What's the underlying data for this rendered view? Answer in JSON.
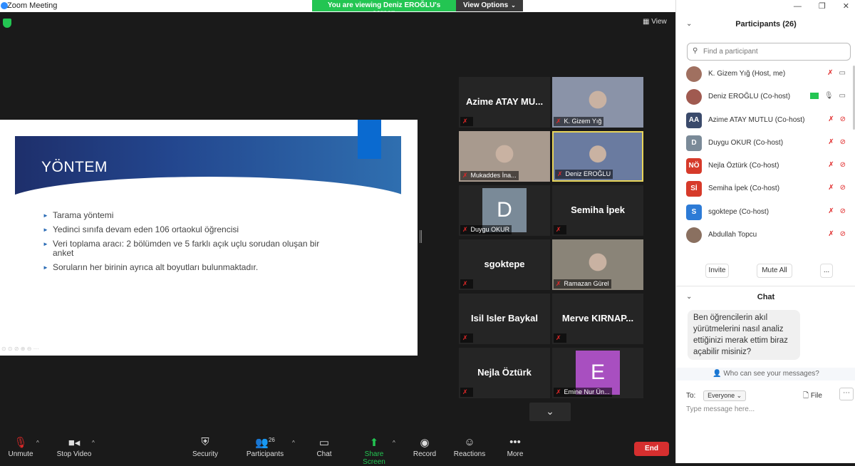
{
  "window": {
    "title": "Zoom Meeting"
  },
  "banner": {
    "viewing": "You are viewing Deniz EROĞLU's screen",
    "view_options": "View Options",
    "caret": "⌄"
  },
  "view_button": {
    "label": "View"
  },
  "slide": {
    "heading": "YÖNTEM",
    "bullets": [
      "Tarama yöntemi",
      "Yedinci sınıfa devam eden 106 ortaokul öğrencisi",
      "Veri toplama aracı: 2 bölümden ve 5 farklı açık uçlu sorudan oluşan bir anket",
      "Soruların her birinin ayrıca alt boyutları bulunmaktadır."
    ],
    "controls": "⊙ ⊙ ⊘ ⊕ ⊖ ⋯"
  },
  "tiles": [
    {
      "name": "Azime ATAY MU...",
      "label": "",
      "type": "name"
    },
    {
      "name": "",
      "label": "K. Gizem Yığ",
      "type": "video",
      "color": "#8a93a8"
    },
    {
      "name": "",
      "label": "Mukaddes İna...",
      "type": "video",
      "color": "#a89a8e"
    },
    {
      "name": "",
      "label": "Deniz EROĞLU",
      "type": "video",
      "color": "#6a7ba0",
      "active": true
    },
    {
      "name": "",
      "label": "Duygu OKUR",
      "type": "letter",
      "letter": "D",
      "color": "#7a8a98"
    },
    {
      "name": "Semiha İpek",
      "label": "",
      "type": "name"
    },
    {
      "name": "sgoktepe",
      "label": "",
      "type": "name"
    },
    {
      "name": "",
      "label": "Ramazan Gürel",
      "type": "video",
      "color": "#8a8478"
    },
    {
      "name": "Isil Isler Baykal",
      "label": "",
      "type": "name"
    },
    {
      "name": "Merve KIRNAP...",
      "label": "",
      "type": "name"
    },
    {
      "name": "Nejla Öztürk",
      "label": "",
      "type": "name"
    },
    {
      "name": "",
      "label": "Emine Nur Ün...",
      "type": "letter",
      "letter": "E",
      "color": "#a84fc0"
    }
  ],
  "toolbar": {
    "unmute": "Unmute",
    "stop_video": "Stop Video",
    "security": "Security",
    "participants": "Participants",
    "participants_count": "26",
    "chat": "Chat",
    "share_screen": "Share Screen",
    "record": "Record",
    "reactions": "Reactions",
    "more": "More",
    "end": "End"
  },
  "panel": {
    "participants_header": "Participants (26)",
    "search_placeholder": "Find a participant",
    "participants": [
      {
        "name": "K. Gizem Yığ (Host, me)",
        "initials": "",
        "color": "#a07060",
        "mic": "muted",
        "video": "on"
      },
      {
        "name": "Deniz EROĞLU (Co-host)",
        "initials": "",
        "color": "#a05a50",
        "mic": "on",
        "video": "on",
        "sharing": true
      },
      {
        "name": "Azime ATAY MUTLU (Co-host)",
        "initials": "AA",
        "color": "#3a4a6b",
        "mic": "muted",
        "video": "off"
      },
      {
        "name": "Duygu OKUR (Co-host)",
        "initials": "D",
        "color": "#7a8a98",
        "mic": "muted",
        "video": "off"
      },
      {
        "name": "Nejla Öztürk (Co-host)",
        "initials": "NÖ",
        "color": "#d63a2a",
        "mic": "muted",
        "video": "off"
      },
      {
        "name": "Semiha İpek (Co-host)",
        "initials": "Sİ",
        "color": "#d63a2a",
        "mic": "muted",
        "video": "off"
      },
      {
        "name": "sgoktepe (Co-host)",
        "initials": "S",
        "color": "#2d7bd6",
        "mic": "muted",
        "video": "off"
      },
      {
        "name": "Abdullah Topcu",
        "initials": "",
        "color": "#8a7060",
        "mic": "muted",
        "video": "off"
      }
    ],
    "invite": "Invite",
    "mute_all": "Mute All",
    "more": "...",
    "chat_header": "Chat",
    "chat_message": "Ben öğrencilerin akıl yürütmelerini nasıl analiz ettiğinizi merak ettim biraz açabilir misiniz?",
    "who_can_see": "Who can see your messages?",
    "to_label": "To:",
    "to_value": "Everyone",
    "file": "File",
    "input_placeholder": "Type message here..."
  }
}
